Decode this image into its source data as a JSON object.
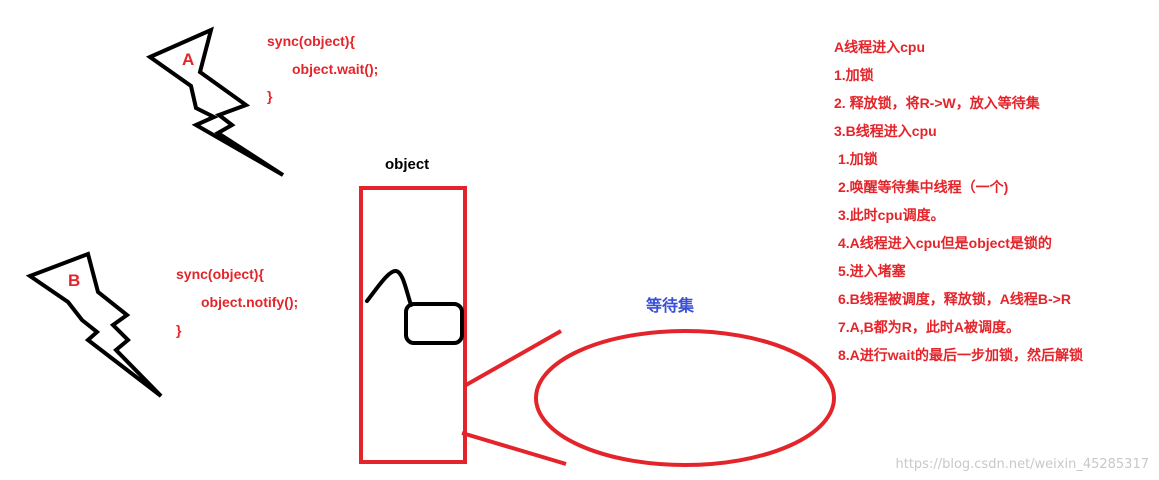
{
  "thread_a": {
    "label": "A"
  },
  "thread_b": {
    "label": "B"
  },
  "code_a": {
    "line1": "sync(object){",
    "line2": "object.wait();",
    "line3": "}"
  },
  "code_b": {
    "line1": "sync(object){",
    "line2": "object.notify();",
    "line3": "}"
  },
  "object_box": {
    "label": "object"
  },
  "wait_set": {
    "label": "等待集"
  },
  "steps": {
    "title": "A线程进入cpu",
    "s1": "1.加锁",
    "s2": "2. 释放锁，将R->W，放入等待集",
    "s3": "3.B线程进入cpu",
    "s4": "1.加锁",
    "s5": "2.唤醒等待集中线程（一个)",
    "s6": "3.此时cpu调度。",
    "s7": "4.A线程进入cpu但是object是锁的",
    "s8": "5.进入堵塞",
    "s9": "6.B线程被调度，释放锁，A线程B->R",
    "s10": "7.A,B都为R，此时A被调度。",
    "s11": "8.A进行wait的最后一步加锁，然后解锁"
  },
  "watermark": "https://blog.csdn.net/weixin_45285317",
  "colors": {
    "red": "#e3252b",
    "black": "#000000",
    "blue": "#3b4fd6"
  }
}
